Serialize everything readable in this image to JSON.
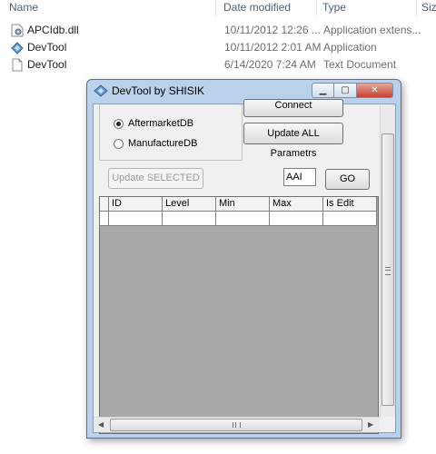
{
  "explorer": {
    "columns": {
      "name": "Name",
      "date_modified": "Date modified",
      "type": "Type",
      "size": "Size"
    },
    "files": [
      {
        "name": "APCIdb.dll",
        "date": "10/11/2012 12:26 ...",
        "type": "Application extens...",
        "icon": "dll-file-icon"
      },
      {
        "name": "DevTool",
        "date": "10/11/2012 2:01 AM",
        "type": "Application",
        "icon": "app-diamond-icon"
      },
      {
        "name": "DevTool",
        "date": "6/14/2020 7:24 AM",
        "type": "Text Document",
        "icon": "text-document-icon"
      }
    ]
  },
  "window": {
    "title": "DevTool by SHISIK",
    "caption": {
      "minimize": "▁",
      "maximize": "▢",
      "close": "✕"
    }
  },
  "form": {
    "db_options": [
      {
        "label": "AftermarketDB",
        "checked": true
      },
      {
        "label": "ManufactureDB",
        "checked": false
      }
    ],
    "connect_label": "Connect",
    "update_all_label": "Update ALL Parametrs",
    "update_selected_label": "Update SELECTED",
    "search_value": "AAI",
    "go_label": "GO"
  },
  "grid": {
    "columns": [
      "ID",
      "Level",
      "Min",
      "Max",
      "Is Edit"
    ]
  },
  "colors": {
    "window_frame": "#b9d1ea",
    "client_bg": "#f0f0f0",
    "grid_bg": "#a9a9a9",
    "close_button": "#c7412f"
  }
}
